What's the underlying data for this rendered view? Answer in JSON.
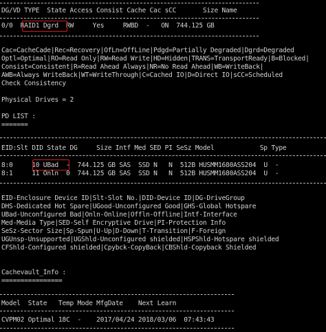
{
  "vd_section": {
    "header": "DG/VD TYPE  State Access Consist Cache Cac sCC       Size Name",
    "row": {
      "dgvd": "0/0",
      "type": "RAID1",
      "state": "Dgrd",
      "rest": "RW     Yes     RWBD  -   ON  744.125 GB"
    }
  },
  "legend_lines": [
    "Cac=CacheCade|Rec=Recovery|OfLn=OffLine|Pdgd=Partially Degraded|Dgrd=Degraded",
    "Optl=Optimal|RO=Read Only|RW=Read Write|HD=Hidden|TRANS=TransportReady|B=Blocked|",
    "Consist=Consistent|R=Read Ahead Always|NR=No Read Ahead|WB=WriteBack|",
    "AWB=Always WriteBack|WT=WriteThrough|C=Cached IO|D=Direct IO|sCC=Scheduled",
    "Check Consistency"
  ],
  "physical_drives": "Physical Drives = 2",
  "pd_list_title": "PD LIST :",
  "pd_list_underline": "=======",
  "pd_section": {
    "header": "EID:Slt DID State DG     Size Intf Med SED PI SeSz Model            Sp Type",
    "rows": [
      {
        "eid_slt": "8:0",
        "did_state": "10 UBad",
        "rest": "-  744.125 GB SAS  SSD N   N  512B HUSMM1680ASS204  U  -"
      },
      {
        "eid_slt": "8:1",
        "did_state": "11 Onln",
        "rest": "0  744.125 GB SAS  SSD N   N  512B HUSMM1680ASS204  U  -"
      }
    ]
  },
  "pd_legend_lines": [
    "EID-Enclosure Device ID|Slt-Slot No.|DID-Device ID|DG-DriveGroup",
    "DHS-Dedicated Hot Spare|UGood-Unconfigured Good|GHS-Global Hotspare",
    "UBad-Unconfigured Bad|Onln-Online|Offln-Offline|Intf-Interface",
    "Med-Media Type|SED-Self Encryptive Drive|PI-Protection Info",
    "SeSz-Sector Size|Sp-Spun|U-Up|D-Down|T-Transition|F-Foreign",
    "UGUnsp-Unsupported|UGShld-Unconfigured shielded|HSPShld-Hotspare shielded",
    "CFShld-Configured shielded|Cpybck-CopyBack|CBShld-Copyback Shielded"
  ],
  "cachevault_title": "Cachevault_Info :",
  "cachevault_underline": "================",
  "cachevault": {
    "header": "Model  State   Temp Mode MfgDate    Next Learn",
    "row": "CVPM02 Optimal 18C  -    2017/04/24 2018/03/06  07:43:43"
  },
  "colors": {
    "background": "#000000",
    "text": "#d4d4d4",
    "highlight_box": "#d81e1e"
  }
}
